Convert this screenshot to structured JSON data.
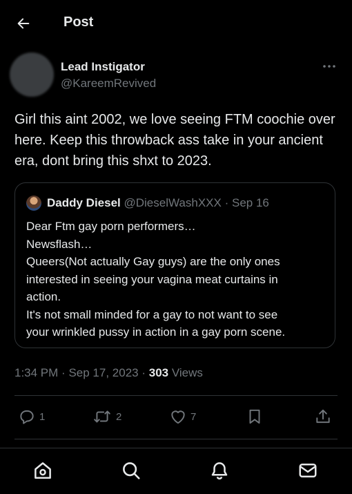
{
  "header": {
    "title": "Post",
    "back_icon": "arrow-left-icon"
  },
  "post": {
    "author": {
      "name": "Lead Instigator",
      "handle": "@KareemRevived"
    },
    "more_icon": "more-horizontal-icon",
    "text": "Girl this aint 2002, we love seeing FTM coochie over here. Keep this throwback ass take in your ancient era, dont bring this shxt to 2023.",
    "quote": {
      "name": "Daddy Diesel",
      "handle": "@DieselWashXXX",
      "date": "Sep 16",
      "lines": [
        "Dear Ftm gay porn performers…",
        "Newsflash…",
        "Queers(Not actually Gay guys) are the only ones",
        "interested in seeing your vagina meat curtains in",
        "action.",
        "It's not small minded for a gay to not want to see",
        "your wrinkled pussy in action in a gay porn scene."
      ]
    },
    "time": "1:34 PM",
    "date": "Sep 17, 2023",
    "views_count": "303",
    "views_label": "Views",
    "separator": "·"
  },
  "actions": {
    "replies": "1",
    "reposts": "2",
    "likes": "7"
  },
  "bottom_nav": [
    "home-icon",
    "search-icon",
    "notifications-bell-icon",
    "messages-mail-icon"
  ],
  "colors": {
    "background": "#000000",
    "text": "#e7e9ea",
    "muted": "#71767b",
    "border": "#2f3336"
  }
}
